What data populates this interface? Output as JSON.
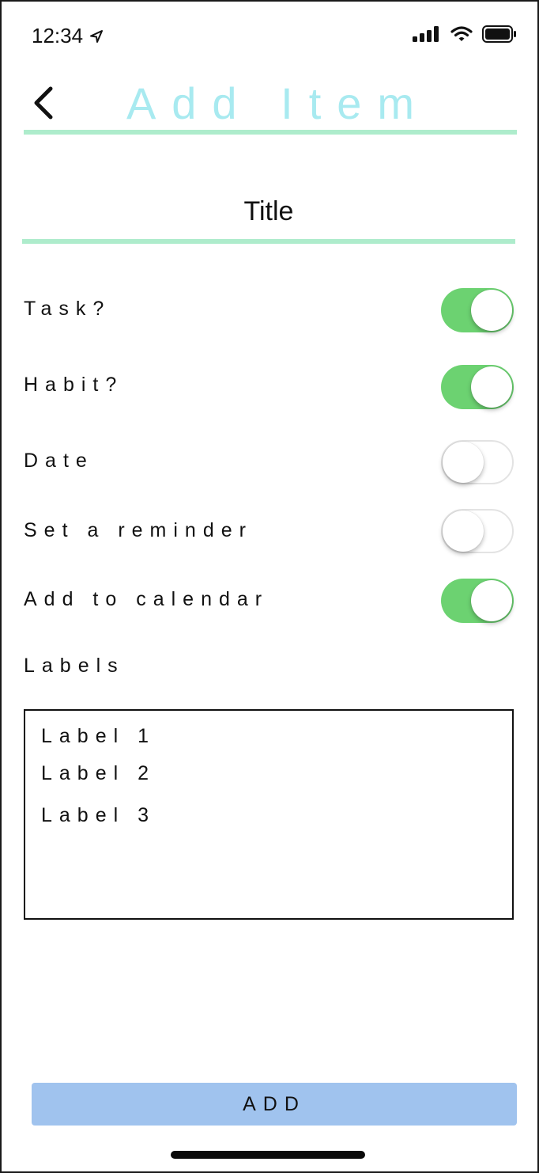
{
  "status_bar": {
    "time": "12:34",
    "icons": [
      "location-arrow-icon",
      "cellular-signal-icon",
      "wifi-icon",
      "battery-icon"
    ]
  },
  "header": {
    "title": "Add Item",
    "back_icon": "chevron-left-icon"
  },
  "title_field": {
    "placeholder": "Title",
    "value": ""
  },
  "options": {
    "task": {
      "label": "Task?",
      "on": true
    },
    "habit": {
      "label": "Habit?",
      "on": true
    },
    "date": {
      "label": "Date",
      "on": false
    },
    "reminder": {
      "label": "Set a reminder",
      "on": false
    },
    "calendar": {
      "label": "Add to calendar",
      "on": true
    }
  },
  "labels_section": {
    "heading": "Labels",
    "items": [
      "Label 1",
      "Label 2",
      "Label 3"
    ]
  },
  "add_button": {
    "label": "ADD"
  },
  "colors": {
    "title": "#a8eaf0",
    "rule": "#aeeccc",
    "switch_on": "#6cd271",
    "button": "#a0c3ee"
  }
}
